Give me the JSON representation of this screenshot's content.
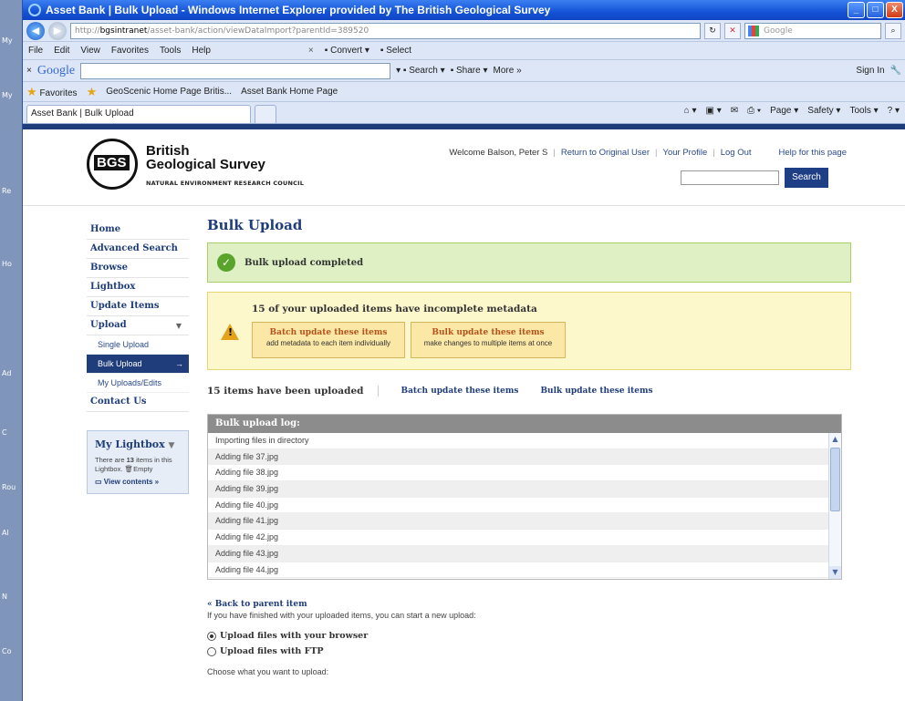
{
  "desktop": {
    "icon_labels": [
      "My",
      "My",
      "Re",
      "Ho",
      "Ad",
      "C",
      "Rou",
      "Al",
      "N",
      "Co"
    ]
  },
  "window": {
    "title": "Asset Bank | Bulk Upload - Windows Internet Explorer provided by The British Geological Survey",
    "controls": [
      "_",
      "□",
      "X"
    ]
  },
  "address": {
    "host": "bgsintranet",
    "url_rest": "/asset-bank/action/viewDataImport?parentId=389520",
    "search_placeholder": "Google"
  },
  "menu": {
    "items": [
      "File",
      "Edit",
      "View",
      "Favorites",
      "Tools",
      "Help"
    ],
    "convert": "Convert",
    "select": "Select"
  },
  "google_bar": {
    "logo": "Google",
    "search": "Search",
    "share": "Share",
    "more": "More »",
    "sign_in": "Sign In"
  },
  "favorites": {
    "label": "Favorites",
    "links": [
      "GeoScenic Home Page Britis...",
      "Asset Bank Home Page"
    ]
  },
  "tab": {
    "label": "Asset Bank | Bulk Upload"
  },
  "commands": [
    "Page",
    "Safety",
    "Tools"
  ],
  "header": {
    "org_line1": "British",
    "org_line2": "Geological Survey",
    "org_sub": "NATURAL ENVIRONMENT RESEARCH COUNCIL",
    "welcome": "Welcome Balson, Peter S",
    "links": [
      "Return to Original User",
      "Your Profile",
      "Log Out"
    ],
    "help": "Help for this page",
    "search_button": "Search"
  },
  "nav": {
    "items": [
      "Home",
      "Advanced Search",
      "Browse",
      "Lightbox",
      "Update Items",
      "Upload"
    ],
    "sub": [
      "Single Upload",
      "Bulk Upload",
      "My Uploads/Edits"
    ],
    "contact": "Contact Us"
  },
  "lightbox": {
    "title": "My Lightbox",
    "text_pre": "There are",
    "count": "13",
    "text_post": "items in this Lightbox.",
    "empty": "Empty",
    "view": "View contents »"
  },
  "main": {
    "title": "Bulk Upload",
    "success": "Bulk upload completed",
    "warning_title": "15 of your uploaded items have incomplete metadata",
    "batch_btn": {
      "title": "Batch update these items",
      "sub": "add metadata to each item individually"
    },
    "bulk_btn": {
      "title": "Bulk update these items",
      "sub": "make changes to multiple items at once"
    },
    "uploaded_count": "15 items have been uploaded",
    "link_batch": "Batch update these items",
    "link_bulk": "Bulk update these items",
    "log_title": "Bulk upload log:",
    "log_rows": [
      "Importing files in directory",
      "Adding file 37.jpg",
      "Adding file 38.jpg",
      "Adding file 39.jpg",
      "Adding file 40.jpg",
      "Adding file 41.jpg",
      "Adding file 42.jpg",
      "Adding file 43.jpg",
      "Adding file 44.jpg"
    ],
    "back": "« Back to parent item",
    "note": "If you have finished with your uploaded items, you can start a new upload:",
    "radio1": "Upload files with your browser",
    "radio2": "Upload files with FTP",
    "choose": "Choose what you want to upload:"
  }
}
